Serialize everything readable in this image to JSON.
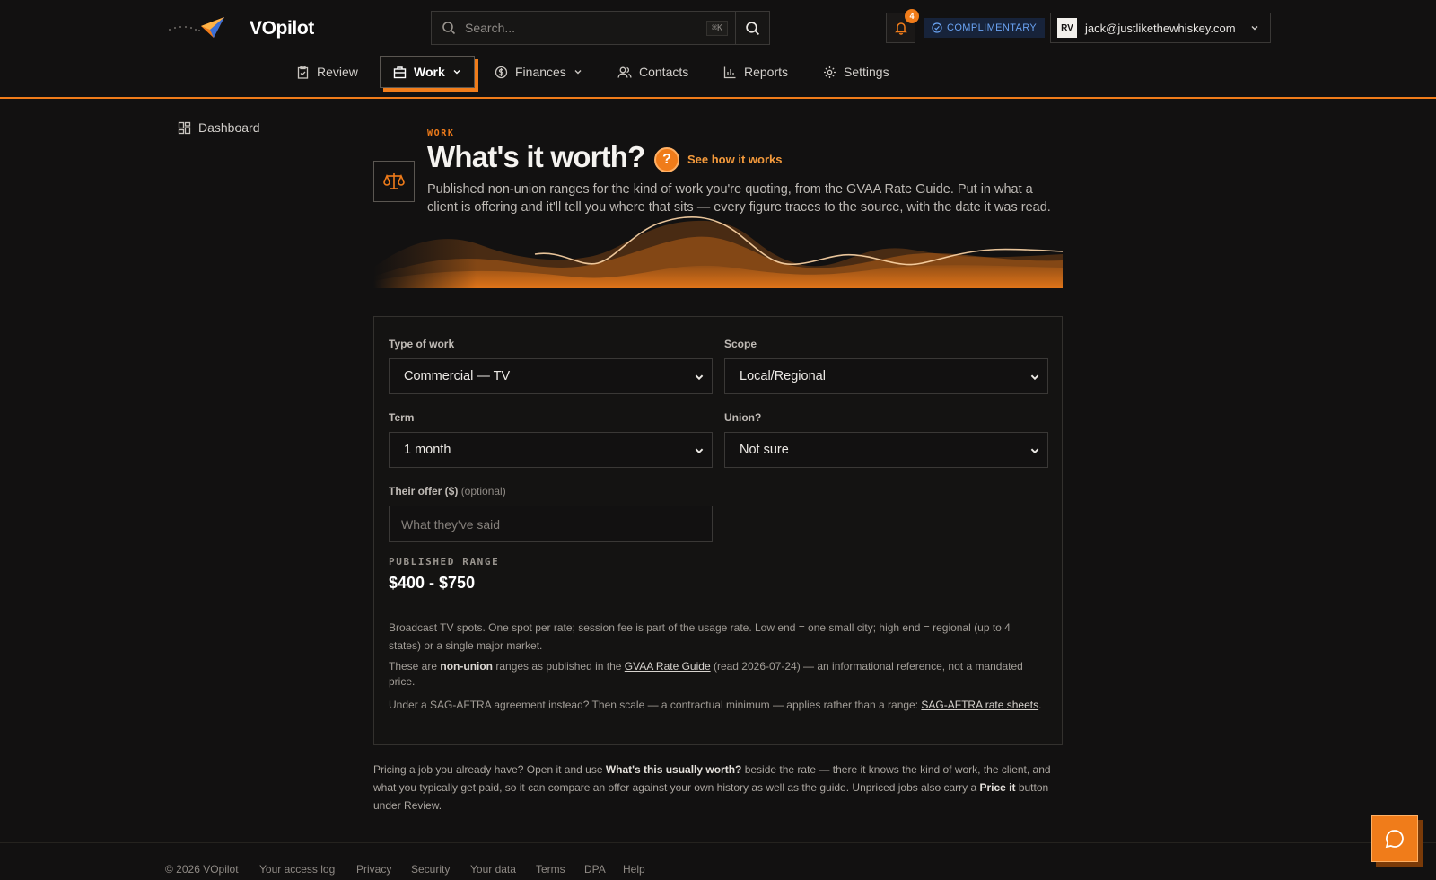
{
  "brand": {
    "name": "VOpilot"
  },
  "search": {
    "placeholder": "Search...",
    "shortcut": "⌘K"
  },
  "notifications": {
    "count": "4"
  },
  "plan_badge": "COMPLIMENTARY",
  "user": {
    "initials": "RV",
    "email": "jack@justlikethewhiskey.com"
  },
  "nav": {
    "dashboard": "Dashboard",
    "review": "Review",
    "work": "Work",
    "finances": "Finances",
    "contacts": "Contacts",
    "reports": "Reports",
    "settings": "Settings"
  },
  "page": {
    "eyebrow": "WORK",
    "title": "What's it worth?",
    "help_link": "See how it works",
    "intro": "Published non-union ranges for the kind of work you're quoting, from the GVAA Rate Guide. Put in what a client is offering and it'll tell you where that sits — every figure traces to the source, with the date it was read."
  },
  "form": {
    "type_label": "Type of work",
    "type_value": "Commercial — TV",
    "scope_label": "Scope",
    "scope_value": "Local/Regional",
    "term_label": "Term",
    "term_value": "1 month",
    "union_label": "Union?",
    "union_value": "Not sure",
    "offer_label": "Their offer ($)",
    "offer_optional": "(optional)",
    "offer_placeholder": "What they've said"
  },
  "result": {
    "label": "PUBLISHED RANGE",
    "range": "$400 - $750",
    "description": "Broadcast TV spots. One spot per rate; session fee is part of the usage rate. Low end = one small city; high end = regional (up to 4 states) or a single major market.",
    "source_prefix": "These are ",
    "source_bold": "non-union",
    "source_mid": " ranges as published in the ",
    "source_link": "GVAA Rate Guide",
    "source_suffix": " (read 2026-07-24) — an informational reference, not a mandated price.",
    "sag_prefix": "Under a SAG-AFTRA agreement instead? Then scale — a contractual minimum — applies rather than a range: ",
    "sag_link": "SAG-AFTRA rate sheets",
    "sag_suffix": "."
  },
  "bottom_note": {
    "part1": "Pricing a job you already have? Open it and use ",
    "bold1": "What's this usually worth?",
    "part2": " beside the rate — there it knows the kind of work, the client, and what you typically get paid, so it can compare an offer against your own history as well as the guide. Unpriced jobs also carry a ",
    "bold2": "Price it",
    "part3": " button under Review."
  },
  "footer": {
    "copyright": "© 2026 VOpilot",
    "access_log": "Your access log",
    "privacy": "Privacy",
    "security": "Security",
    "your_data": "Your data",
    "terms": "Terms",
    "dpa": "DPA",
    "help": "Help"
  },
  "colors": {
    "accent": "#f07c1a",
    "background": "#121111",
    "plan_badge_text": "#6aa3f2"
  },
  "icons": {
    "logo": "paper-plane-logo-icon",
    "search": "search-icon",
    "bell": "bell-icon",
    "scale": "scale-icon",
    "chat": "chat-bubble-icon"
  }
}
